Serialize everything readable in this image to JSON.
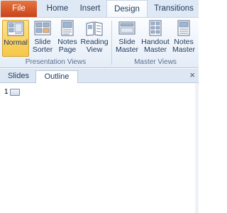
{
  "tabs": {
    "file": "File",
    "home": "Home",
    "insert": "Insert",
    "design": "Design",
    "transitions": "Transitions"
  },
  "ribbon": {
    "presentation_views": {
      "label": "Presentation Views",
      "buttons": [
        {
          "line1": "Normal",
          "line2": "",
          "icon": "normal-view-icon"
        },
        {
          "line1": "Slide",
          "line2": "Sorter",
          "icon": "slide-sorter-icon"
        },
        {
          "line1": "Notes",
          "line2": "Page",
          "icon": "notes-page-icon"
        },
        {
          "line1": "Reading",
          "line2": "View",
          "icon": "reading-view-icon"
        }
      ]
    },
    "master_views": {
      "label": "Master Views",
      "buttons": [
        {
          "line1": "Slide",
          "line2": "Master",
          "icon": "slide-master-icon"
        },
        {
          "line1": "Handout",
          "line2": "Master",
          "icon": "handout-master-icon"
        },
        {
          "line1": "Notes",
          "line2": "Master",
          "icon": "notes-master-icon"
        }
      ]
    }
  },
  "pane": {
    "tab_slides": "Slides",
    "tab_outline": "Outline",
    "close_glyph": "×",
    "outline_rows": [
      {
        "number": "1"
      }
    ]
  },
  "colors": {
    "file_tab": "#d9572a",
    "active_button": "#f8d56a",
    "ribbon_bg": "#e4ecf7"
  }
}
